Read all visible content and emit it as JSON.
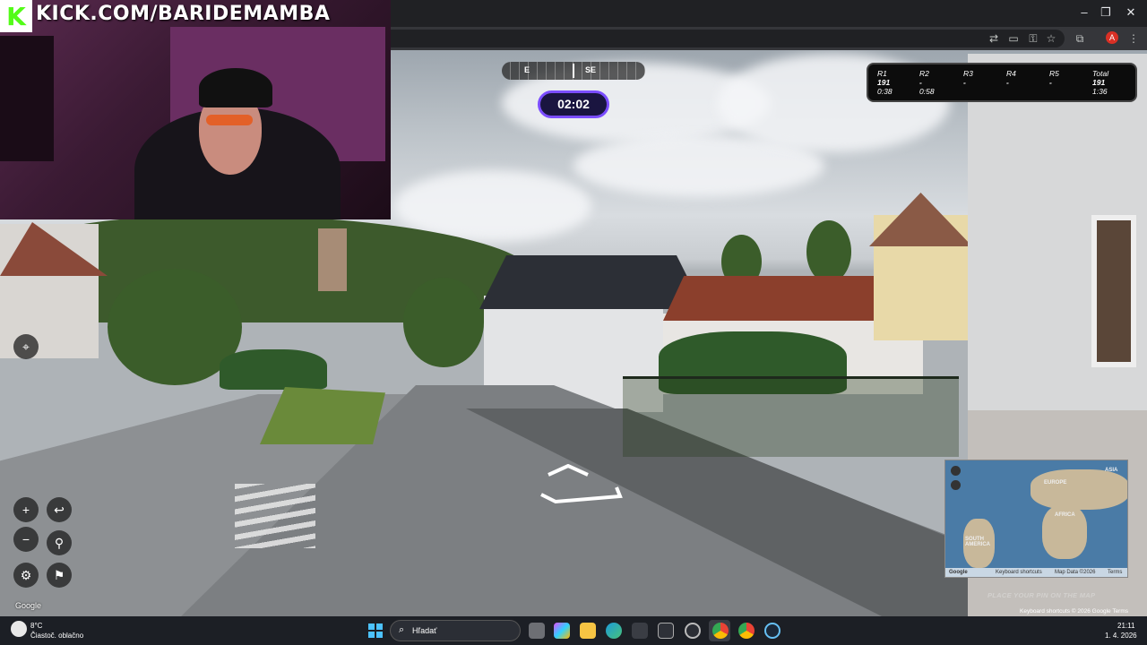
{
  "stream": {
    "url": "KICK.COM/BARIDEMAMBA",
    "logo_letter": "K"
  },
  "browser": {
    "window_controls": [
      "–",
      "❐",
      "✕"
    ],
    "profile_letter": "A"
  },
  "game": {
    "compass": {
      "left_label": "E",
      "center_label": "SE"
    },
    "timer": "02:02",
    "scores": [
      {
        "round": "R1",
        "points": "191",
        "time": "0:38"
      },
      {
        "round": "R2",
        "points": "-",
        "time": "0:58"
      },
      {
        "round": "R3",
        "points": "-",
        "time": ""
      },
      {
        "round": "R4",
        "points": "-",
        "time": ""
      },
      {
        "round": "R5",
        "points": "-",
        "time": ""
      },
      {
        "round": "Total",
        "points": "191",
        "time": "1:36"
      }
    ],
    "place_pin_hint": "PLACE YOUR PIN ON THE MAP"
  },
  "map": {
    "continents": [
      "EUROPE",
      "ASIA",
      "AFRICA",
      "SOUTH AMERICA"
    ],
    "footer_shortcuts": "Keyboard shortcuts",
    "footer_data": "Map Data ©2026",
    "footer_terms": "Terms",
    "google_mark": "Google"
  },
  "streetview": {
    "google_mark": "Google",
    "footer": "Keyboard shortcuts   © 2026 Google   Terms"
  },
  "taskbar": {
    "weather_temp": "8°C",
    "weather_desc": "Čiastoč. oblačno",
    "search_placeholder": "Hľadať",
    "time": "21:11",
    "date": "1. 4. 2026"
  },
  "colors": {
    "kick_green": "#53fc18",
    "timer_border": "#7b4dff",
    "taskbar_bg": "#1c1f25"
  }
}
